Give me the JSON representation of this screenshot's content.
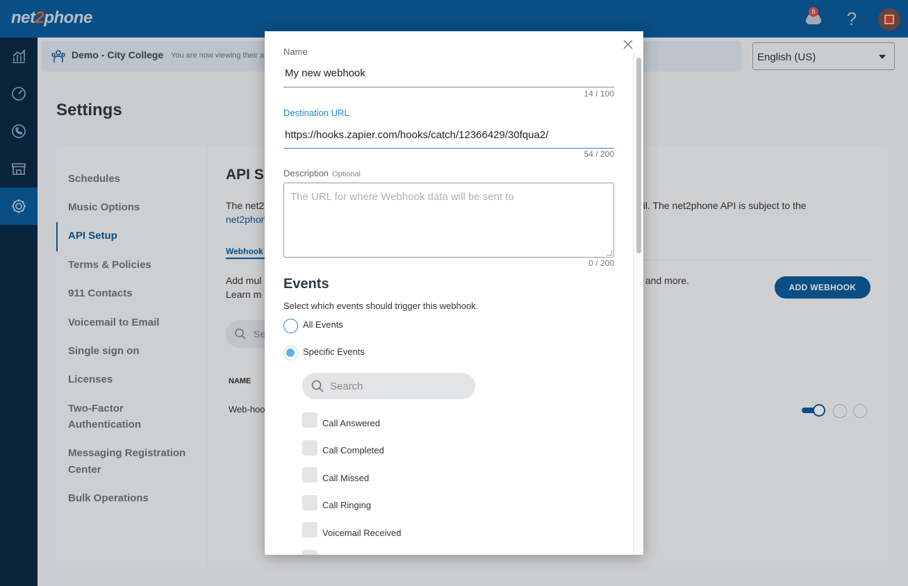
{
  "header": {
    "logo_left": "net",
    "logo_mid": "2",
    "logo_right": "phone",
    "notification_count": "8"
  },
  "banner": {
    "title": "Demo - City College",
    "subtitle": "You are now viewing their a"
  },
  "language": {
    "selected": "English (US)"
  },
  "page": {
    "title": "Settings"
  },
  "settings_menu": [
    {
      "label": "Schedules"
    },
    {
      "label": "Music Options"
    },
    {
      "label": "API Setup"
    },
    {
      "label": "Terms & Policies"
    },
    {
      "label": "911 Contacts"
    },
    {
      "label": "Voicemail to Email"
    },
    {
      "label": "Single sign on"
    },
    {
      "label": "Licenses"
    },
    {
      "label": "Two-Factor"
    },
    {
      "label": "Authentication"
    },
    {
      "label": "Messaging Registration"
    },
    {
      "label": "Center"
    },
    {
      "label": "Bulk Operations"
    }
  ],
  "api": {
    "title": "API S",
    "text1": "The net2",
    "link1": "net2phon",
    "text_right": "ail. The net2phone API is subject to the",
    "tab": "Webhook",
    "add_line1": "Add mul",
    "add_line2": "Learn m",
    "add_more": "s and more.",
    "add_button": "ADD WEBHOOK",
    "search_label": "Se",
    "col_name": "NAME",
    "row_name": "Web-hoo"
  },
  "modal": {
    "name_label": "Name",
    "name_value": "My new webhook",
    "name_counter": "14 / 100",
    "url_label": "Destination URL",
    "url_value": "https://hooks.zapier.com/hooks/catch/12366429/30fqua2/",
    "url_counter": "54 / 200",
    "desc_label": "Description",
    "desc_optional": "Optional",
    "desc_placeholder": "The URL for where Webhook data will be sent to",
    "desc_counter": "0 / 200",
    "events_title": "Events",
    "events_sub": "Select which events should trigger this webhook.",
    "radio_all": "All Events",
    "radio_specific": "Specific Events",
    "search_placeholder": "Search",
    "events": [
      {
        "label": "Call Answered",
        "checked": false
      },
      {
        "label": "Call Completed",
        "checked": false
      },
      {
        "label": "Call Missed",
        "checked": false
      },
      {
        "label": "Call Ringing",
        "checked": false
      },
      {
        "label": "Voicemail Received",
        "checked": false
      }
    ]
  },
  "colors": {
    "brand": "#0b5c9c",
    "nav_dark": "#0b2a48",
    "focus": "#1a8ad4",
    "radio_checked": "#5ab4ec"
  },
  "icons": {
    "nav": [
      "chart-icon",
      "gauge-icon",
      "phone-icon",
      "store-icon",
      "gear-icon"
    ],
    "top": [
      "notification-icon",
      "help-icon",
      "avatar"
    ]
  }
}
